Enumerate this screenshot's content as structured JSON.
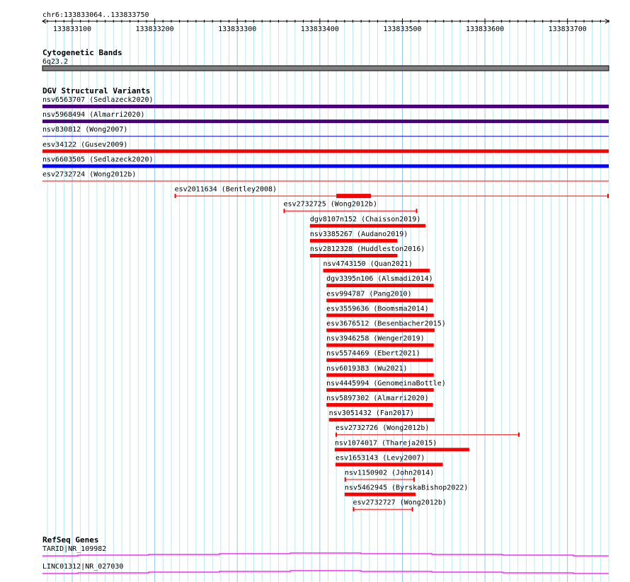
{
  "ruler": {
    "location": "chr6:133833064..133833750",
    "start": 133833064,
    "end": 133833750,
    "tick_labels": [
      "133833100",
      "133833200",
      "133833300",
      "133833400",
      "133833500",
      "133833600",
      "133833700"
    ]
  },
  "cytoband": {
    "title": "Cytogenetic Bands",
    "band": "6q23.2",
    "color": "#808080"
  },
  "dgv": {
    "title": "DGV Structural Variants",
    "features": [
      {
        "label": "nsv6563707 (Sedlazeck2020)",
        "start": 133833064,
        "end": 133833750,
        "style": "thick",
        "color": "#4b0082"
      },
      {
        "label": "nsv5968494 (Almarri2020)",
        "start": 133833064,
        "end": 133833750,
        "style": "thick",
        "color": "#4b0082"
      },
      {
        "label": "nsv830812 (Wong2007)",
        "start": 133833064,
        "end": 133833750,
        "style": "thin",
        "color": "#0000cc"
      },
      {
        "label": "esv34122 (Gusev2009)",
        "start": 133833064,
        "end": 133833750,
        "style": "thick",
        "color": "#ff0000"
      },
      {
        "label": "nsv6603505 (Sedlazeck2020)",
        "start": 133833064,
        "end": 133833750,
        "style": "thick",
        "color": "#0000ff"
      },
      {
        "label": "esv2732724 (Wong2012b)",
        "start": 133833064,
        "end": 133833750,
        "style": "thin",
        "color": "#ff0000"
      },
      {
        "label": "esv2011634 (Bentley2008)",
        "start": 133833224,
        "end": 133833750,
        "style": "capped",
        "color": "#ff0000",
        "thick_start": 133833420,
        "thick_end": 133833462
      },
      {
        "label": "esv2732725 (Wong2012b)",
        "start": 133833356,
        "end": 133833518,
        "style": "capped",
        "color": "#ff0000"
      },
      {
        "label": "dgv8107n152 (Chaisson2019)",
        "start": 133833388,
        "end": 133833528,
        "style": "thick",
        "color": "#ff0000"
      },
      {
        "label": "nsv3385267 (Audano2019)",
        "start": 133833388,
        "end": 133833494,
        "style": "thick",
        "color": "#ff0000"
      },
      {
        "label": "nsv2812328 (Huddleston2016)",
        "start": 133833388,
        "end": 133833494,
        "style": "thick",
        "color": "#ff0000"
      },
      {
        "label": "nsv4743150 (Quan2021)",
        "start": 133833404,
        "end": 133833533,
        "style": "thick",
        "color": "#ff0000"
      },
      {
        "label": "dgv3395n106 (Alsmadi2014)",
        "start": 133833408,
        "end": 133833538,
        "style": "thick",
        "color": "#ff0000"
      },
      {
        "label": "esv994787 (Pang2010)",
        "start": 133833408,
        "end": 133833537,
        "style": "thick",
        "color": "#ff0000"
      },
      {
        "label": "esv3559636 (Boomsma2014)",
        "start": 133833408,
        "end": 133833538,
        "style": "thick",
        "color": "#ff0000"
      },
      {
        "label": "esv3676512 (Besenbacher2015)",
        "start": 133833408,
        "end": 133833539,
        "style": "thick",
        "color": "#ff0000"
      },
      {
        "label": "nsv3946258 (Wenger2019)",
        "start": 133833408,
        "end": 133833538,
        "style": "thick",
        "color": "#ff0000"
      },
      {
        "label": "nsv5574469 (Ebert2021)",
        "start": 133833408,
        "end": 133833537,
        "style": "thick",
        "color": "#ff0000"
      },
      {
        "label": "nsv6019383 (Wu2021)",
        "start": 133833408,
        "end": 133833538,
        "style": "thick",
        "color": "#ff0000"
      },
      {
        "label": "nsv4445994 (GenomeinaBottle)",
        "start": 133833408,
        "end": 133833538,
        "style": "thick",
        "color": "#ff0000"
      },
      {
        "label": "nsv5897302 (Almarri2020)",
        "start": 133833408,
        "end": 133833537,
        "style": "thick",
        "color": "#ff0000"
      },
      {
        "label": "nsv3051432 (Fan2017)",
        "start": 133833411,
        "end": 133833539,
        "style": "thick",
        "color": "#ff0000"
      },
      {
        "label": "esv2732726 (Wong2012b)",
        "start": 133833419,
        "end": 133833642,
        "style": "capped",
        "color": "#ff0000"
      },
      {
        "label": "nsv1074017 (Thareja2015)",
        "start": 133833418,
        "end": 133833581,
        "style": "thick",
        "color": "#ff0000"
      },
      {
        "label": "esv1653143 (Levy2007)",
        "start": 133833419,
        "end": 133833549,
        "style": "thick",
        "color": "#ff0000"
      },
      {
        "label": "nsv1150902 (John2014)",
        "start": 133833430,
        "end": 133833515,
        "style": "capped",
        "color": "#ff0000"
      },
      {
        "label": "nsv5462945 (ByrskaBishop2022)",
        "start": 133833430,
        "end": 133833516,
        "style": "thick",
        "color": "#ff0000"
      },
      {
        "label": "esv2732727 (Wong2012b)",
        "start": 133833440,
        "end": 133833513,
        "style": "capped",
        "color": "#ff0000"
      }
    ]
  },
  "refseq": {
    "title": "RefSeq Genes",
    "color": "#ff00ff",
    "genes": [
      {
        "label": "TARID|NR_109982"
      },
      {
        "label": "LINC01312|NR_027030"
      }
    ]
  }
}
